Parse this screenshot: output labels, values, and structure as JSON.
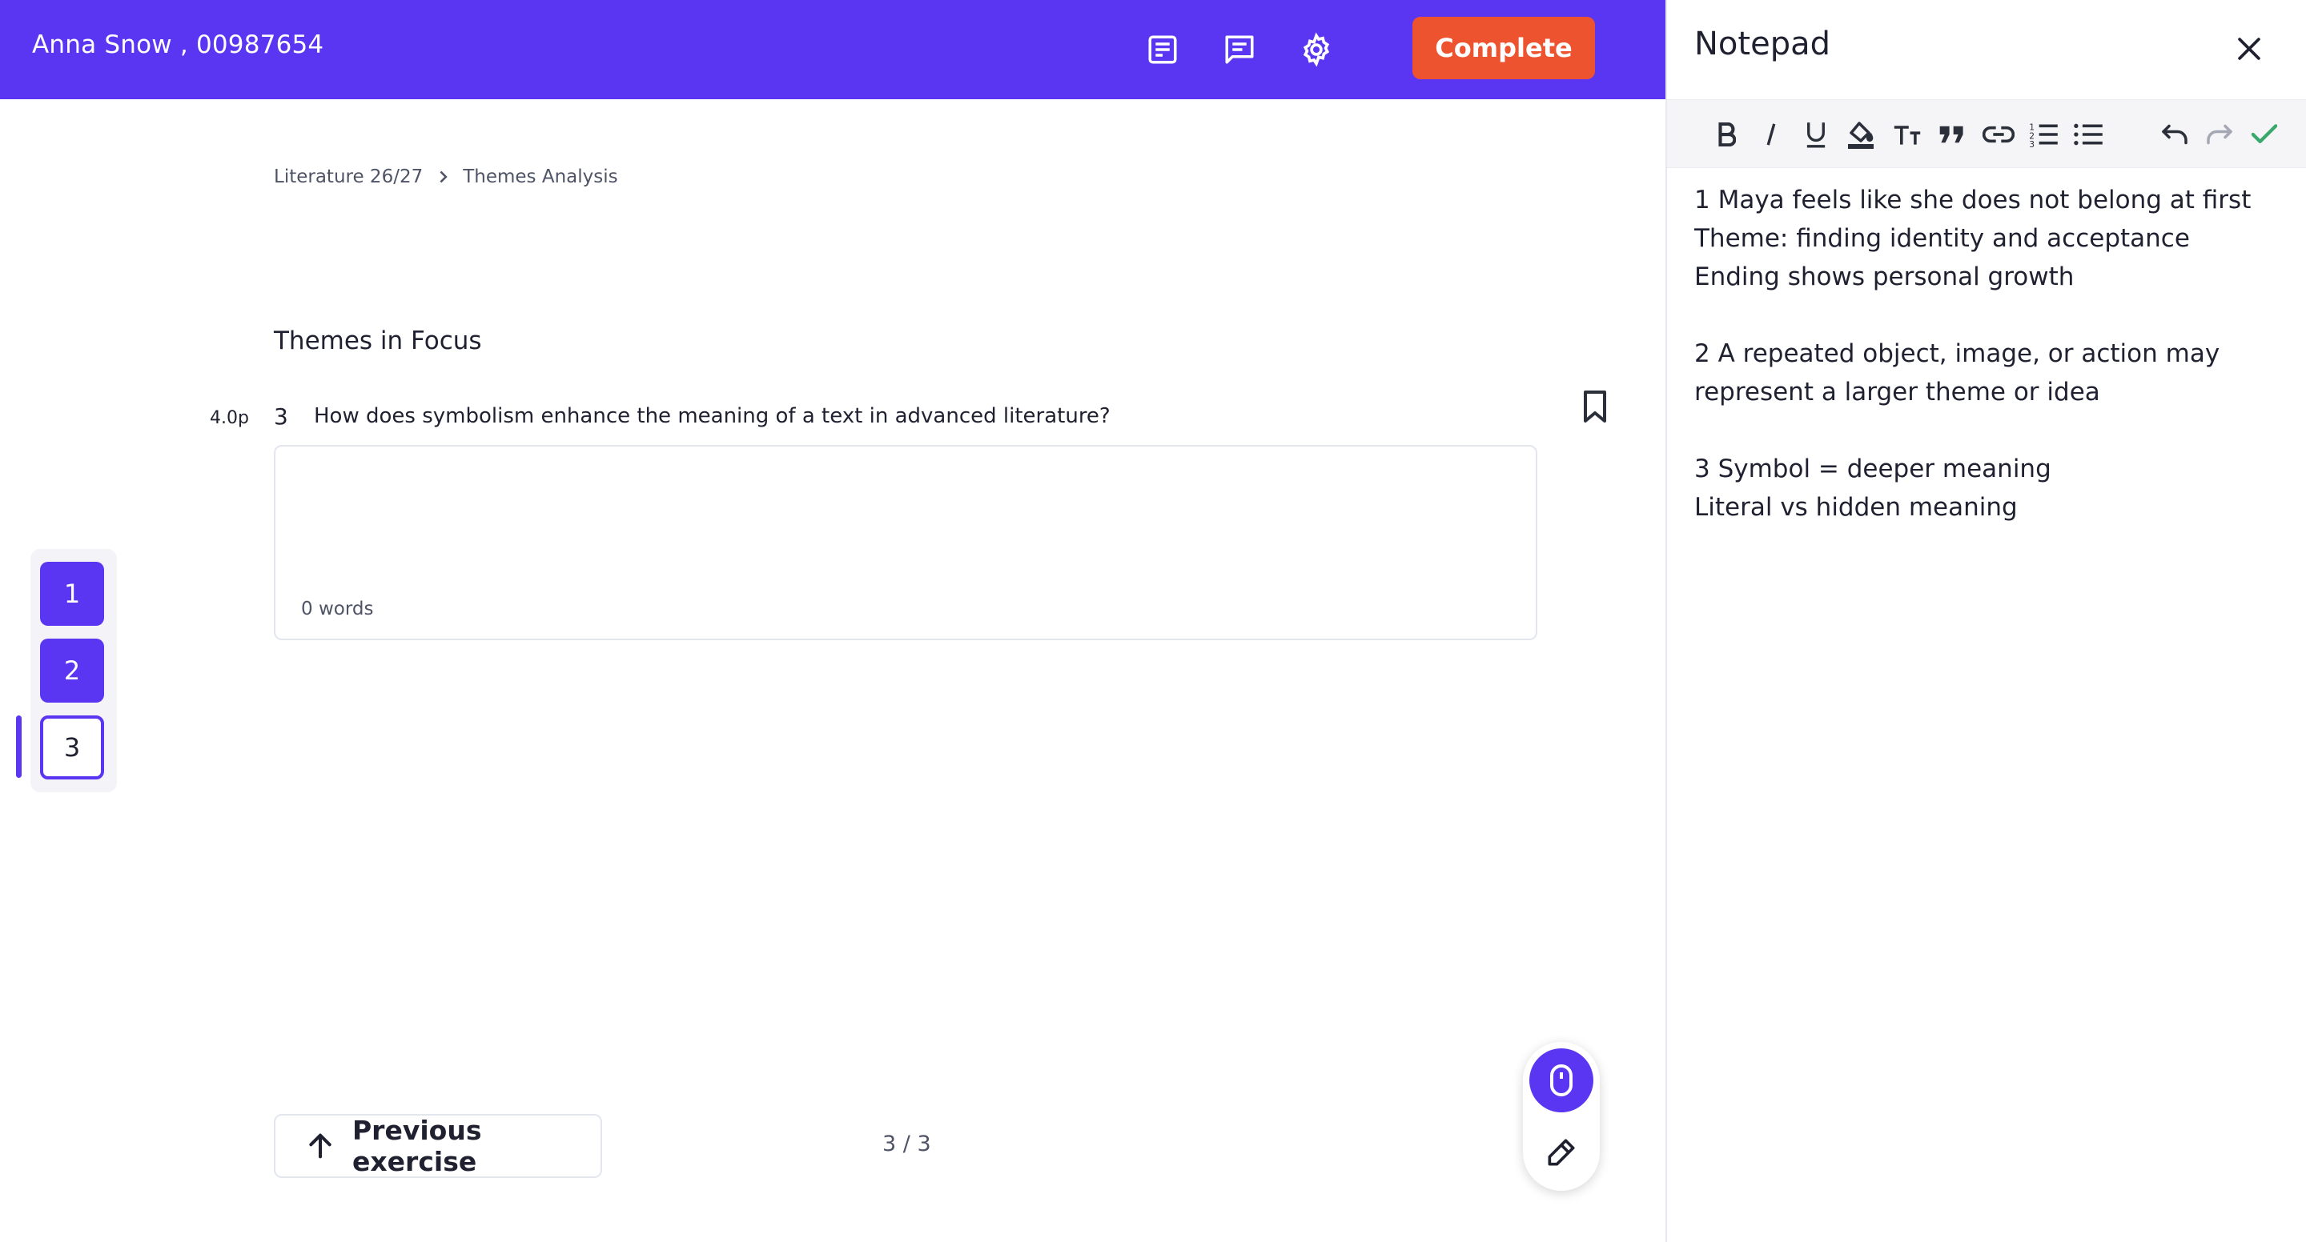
{
  "header": {
    "student": "Anna Snow , 00987654",
    "complete_label": "Complete",
    "icons": [
      "notes-icon",
      "chat-icon",
      "settings-icon"
    ]
  },
  "breadcrumb": {
    "course": "Literature 26/27",
    "page": "Themes Analysis"
  },
  "section": {
    "title": "Themes in Focus"
  },
  "question": {
    "points": "4.0p",
    "number": "3",
    "text": "How does symbolism enhance the meaning of a text in advanced literature?",
    "answer_value": "",
    "word_count": "0 words"
  },
  "question_nav": {
    "items": [
      {
        "label": "1",
        "state": "answered"
      },
      {
        "label": "2",
        "state": "answered"
      },
      {
        "label": "3",
        "state": "current"
      }
    ]
  },
  "footer": {
    "previous_label": "Previous exercise",
    "page_count": "3 / 3"
  },
  "tools": [
    "mouse-icon",
    "pen-icon"
  ],
  "notepad": {
    "title": "Notepad",
    "toolbar": [
      "bold",
      "italic",
      "underline",
      "highlight",
      "text-size",
      "quote",
      "link",
      "ordered-list",
      "bullet-list",
      "undo",
      "redo",
      "confirm"
    ],
    "lines": [
      "1 Maya feels like she does not belong at first",
      "Theme: finding identity and acceptance",
      "Ending shows personal growth",
      "",
      "2 A repeated object, image, or action may",
      "represent a larger theme or idea",
      "",
      "3 Symbol = deeper meaning",
      "Literal vs hidden meaning"
    ]
  },
  "colors": {
    "brand": "#5b36f2",
    "complete": "#ee5330",
    "confirm": "#3aa76d"
  }
}
